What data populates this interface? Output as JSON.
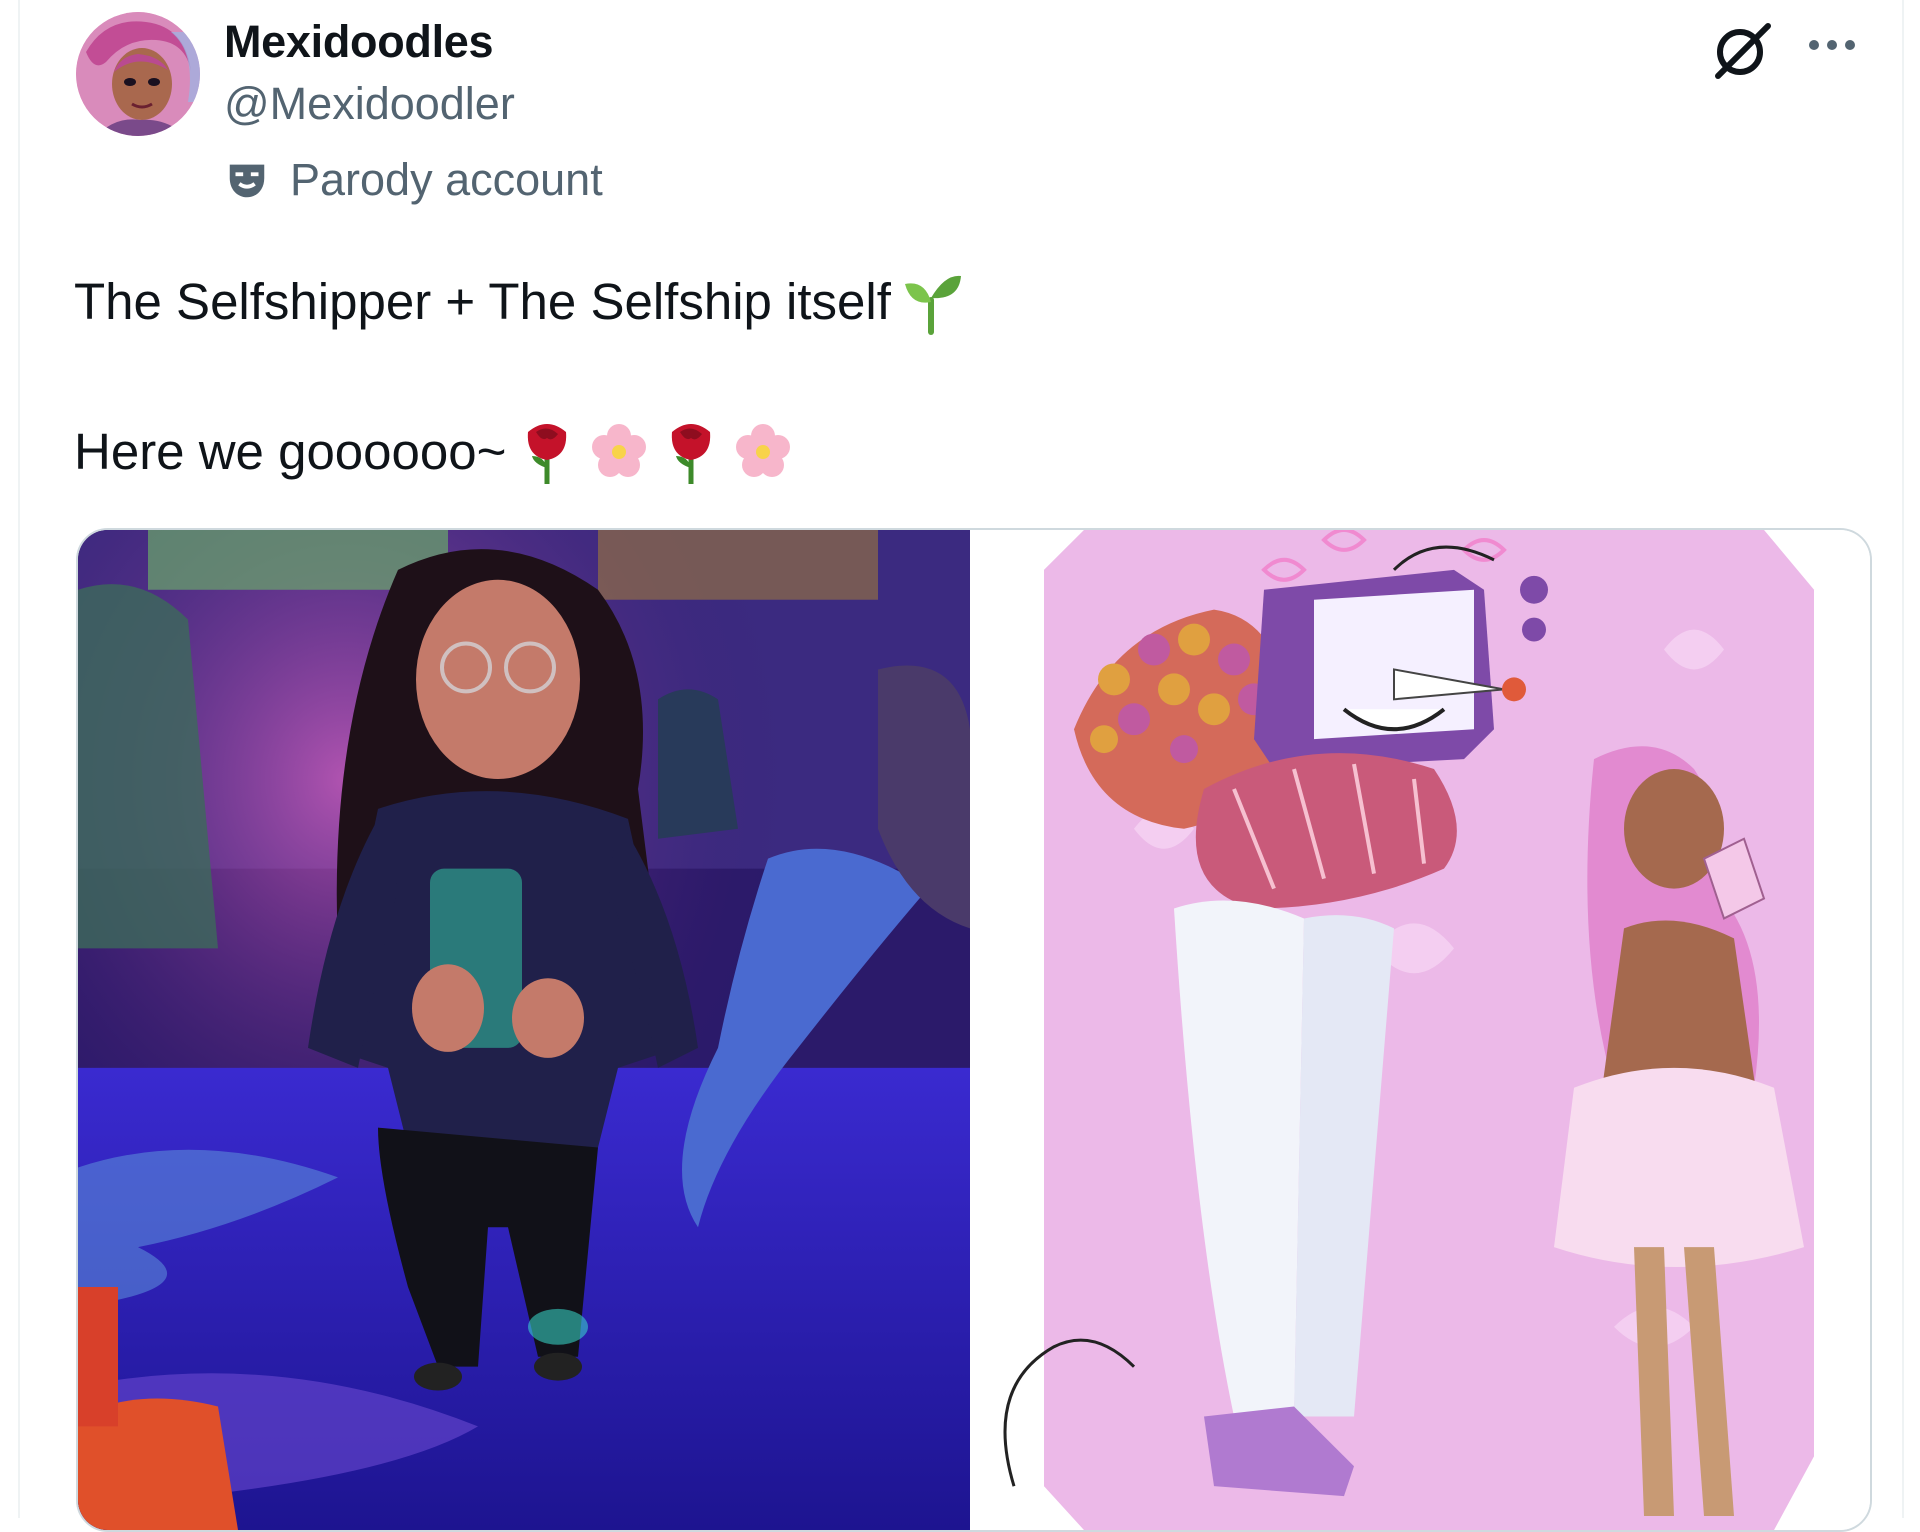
{
  "user": {
    "display_name": "Mexidoodles",
    "handle": "@Mexidoodler",
    "parody_label": "Parody account",
    "avatar": "avatar-illustration"
  },
  "icons": {
    "grok": "grok-icon",
    "more": "more-options-icon",
    "parody": "theater-mask-icon"
  },
  "tweet": {
    "line1": "The Selfshipper + The Selfship itself",
    "line1_emoji": [
      "seedling"
    ],
    "line2": "Here we goooooo~",
    "line2_emoji": [
      "rose",
      "cherry-blossom",
      "rose",
      "cherry-blossom"
    ]
  },
  "media": {
    "images": [
      {
        "name": "photo-selfie",
        "kind": "photo"
      },
      {
        "name": "illustration-selfship",
        "kind": "illustration"
      }
    ]
  },
  "colors": {
    "text_primary": "#0f1419",
    "text_secondary": "#536471",
    "border": "#cfd9de"
  }
}
